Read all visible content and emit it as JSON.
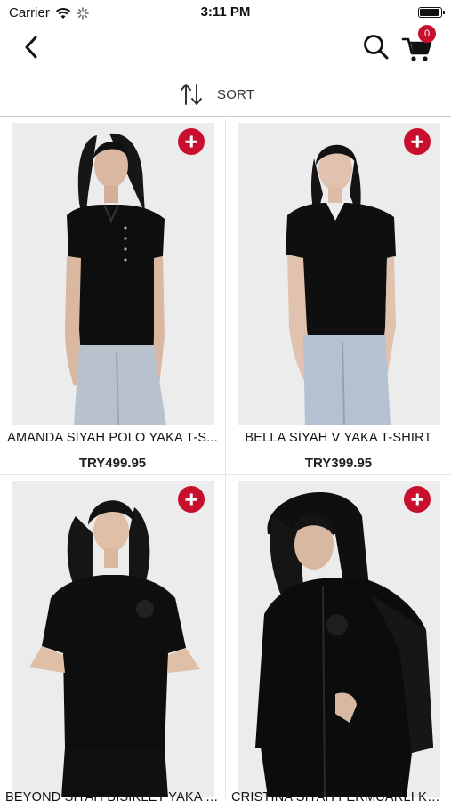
{
  "status_bar": {
    "carrier": "Carrier",
    "time": "3:11 PM",
    "battery_level_percent": 95
  },
  "nav_bar": {
    "back_icon": "chevron-left-icon",
    "search_icon": "search-icon",
    "cart_icon": "shopping-cart-icon",
    "cart_count": "0"
  },
  "sort_bar": {
    "icon": "sort-arrows-icon",
    "label": "SORT"
  },
  "colors": {
    "accent": "#c8102e",
    "divider": "#c9c9c9",
    "grid_background": "#e7e7e7"
  },
  "products": [
    {
      "name": "AMANDA SİYAH POLO YAKA T-S...",
      "price": "TRY499.95",
      "add_icon": "plus-icon"
    },
    {
      "name": "BELLA SİYAH V YAKA T-SHIRT",
      "price": "TRY399.95",
      "add_icon": "plus-icon"
    },
    {
      "name": "BEYOND SİYAH BİSİKLET YAKA T...",
      "price": "",
      "add_icon": "plus-icon"
    },
    {
      "name": "CRISTINA SİYAH FERMUARLI KA...",
      "price": "",
      "add_icon": "plus-icon"
    }
  ]
}
